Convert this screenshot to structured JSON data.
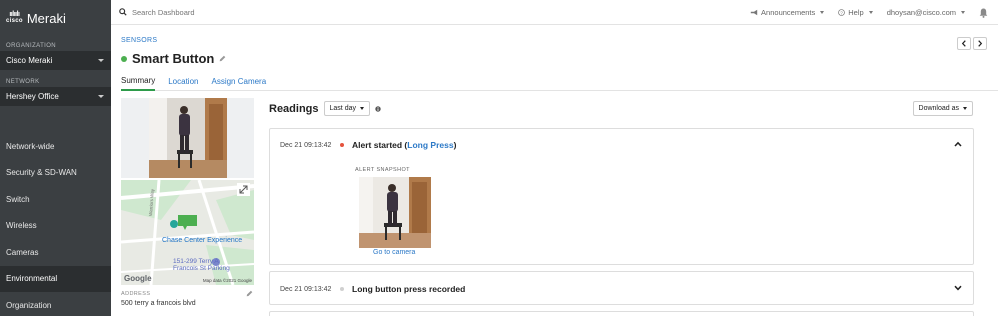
{
  "sidebar": {
    "brand_small": "cisco",
    "brand": "Meraki",
    "org_label": "ORGANIZATION",
    "org_value": "Cisco Meraki",
    "network_label": "NETWORK",
    "network_value": "Hershey Office",
    "items": [
      {
        "label": "Network-wide",
        "active": false
      },
      {
        "label": "Security & SD-WAN",
        "active": false
      },
      {
        "label": "Switch",
        "active": false
      },
      {
        "label": "Wireless",
        "active": false
      },
      {
        "label": "Cameras",
        "active": false
      },
      {
        "label": "Environmental",
        "active": true
      },
      {
        "label": "Organization",
        "active": false
      }
    ]
  },
  "topbar": {
    "search_placeholder": "Search Dashboard",
    "announcements": "Announcements",
    "help": "Help",
    "user": "dhoysan@cisco.com"
  },
  "header": {
    "breadcrumb": "SENSORS",
    "title": "Smart Button",
    "status_color": "#4caf50"
  },
  "tabs": [
    "Summary",
    "Location",
    "Assign Camera"
  ],
  "map": {
    "place": "Chase Center Experience",
    "parking": "151-299 Terry A Francois St Parking",
    "parking_line1": "151-299 Terry A",
    "parking_line2": "Francois St Parking",
    "google": "Google",
    "attribution": "Map data ©2021 Google",
    "street": "Warriors Way"
  },
  "address": {
    "label": "ADDRESS",
    "value": "500 terry a francois blvd"
  },
  "readings": {
    "title": "Readings",
    "range": "Last day",
    "download": "Download as",
    "events": [
      {
        "timestamp": "Dec 21 09:13:42",
        "title_prefix": "Alert started (",
        "title_link": "Long Press",
        "title_suffix": ")",
        "dot_color": "#e5533d",
        "expanded": true,
        "snapshot_label": "ALERT SNAPSHOT",
        "snapshot_link": "Go to camera"
      },
      {
        "timestamp": "Dec 21 09:13:42",
        "title": "Long button press recorded",
        "dot_color": "#cccccc",
        "expanded": false
      }
    ]
  },
  "colors": {
    "sidebar_bg": "#3b3f42",
    "sidebar_active": "#2b2e30",
    "link": "#2c79c7",
    "tab_underline": "#2d9b4a"
  }
}
